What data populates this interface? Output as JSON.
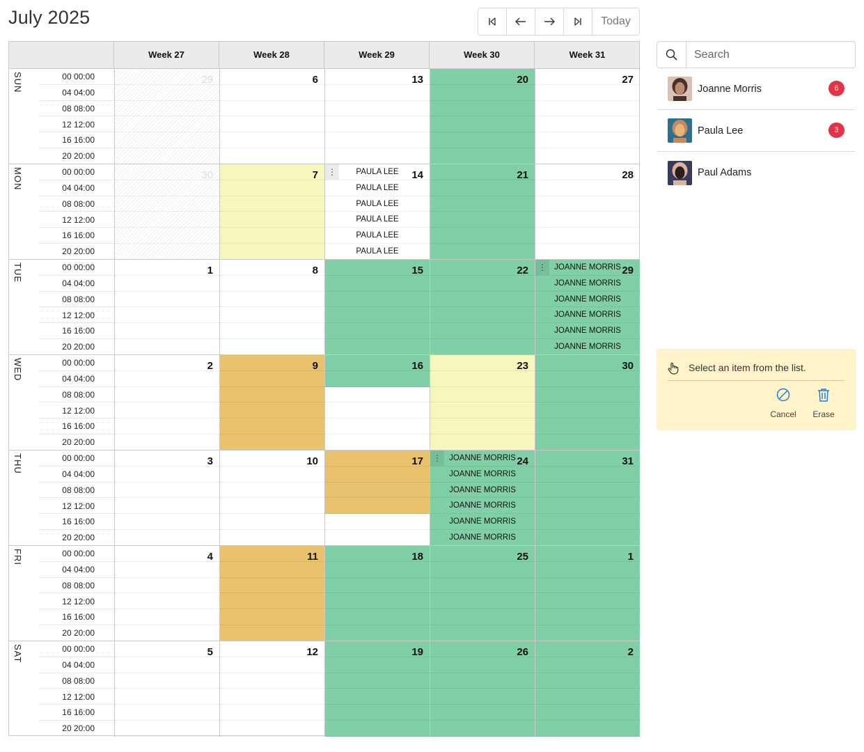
{
  "header": {
    "title": "July 2025"
  },
  "nav": {
    "first": "first-page",
    "prev": "previous",
    "next": "next",
    "last": "last-page",
    "today_label": "Today"
  },
  "weeks": [
    "Week 27",
    "Week 28",
    "Week 29",
    "Week 30",
    "Week 31"
  ],
  "times": [
    "00 00:00",
    "04 04:00",
    "08 08:00",
    "12 12:00",
    "16 16:00",
    "20 20:00"
  ],
  "days": [
    {
      "label": "SUN",
      "cells": [
        {
          "num": "29",
          "faint": true,
          "style": "hatch"
        },
        {
          "num": "6"
        },
        {
          "num": "13"
        },
        {
          "num": "20",
          "style": "green"
        },
        {
          "num": "27"
        }
      ]
    },
    {
      "label": "MON",
      "cells": [
        {
          "num": "30",
          "faint": true,
          "style": "hatch"
        },
        {
          "num": "7",
          "style": "yellow"
        },
        {
          "num": "14",
          "events": [
            "PAULA LEE",
            "PAULA LEE",
            "PAULA LEE",
            "PAULA LEE",
            "PAULA LEE",
            "PAULA LEE"
          ]
        },
        {
          "num": "21",
          "style": "green"
        },
        {
          "num": "28"
        }
      ]
    },
    {
      "label": "TUE",
      "cells": [
        {
          "num": "1"
        },
        {
          "num": "8"
        },
        {
          "num": "15",
          "style": "green"
        },
        {
          "num": "22",
          "style": "green"
        },
        {
          "num": "29",
          "style": "green",
          "events": [
            "JOANNE MORRIS",
            "JOANNE MORRIS",
            "JOANNE MORRIS",
            "JOANNE MORRIS",
            "JOANNE MORRIS",
            "JOANNE MORRIS"
          ]
        }
      ]
    },
    {
      "label": "WED",
      "cells": [
        {
          "num": "2"
        },
        {
          "num": "9",
          "style": "orange"
        },
        {
          "num": "16",
          "slots": [
            "green",
            "green",
            "",
            "",
            "",
            ""
          ]
        },
        {
          "num": "23",
          "style": "yellow"
        },
        {
          "num": "30",
          "style": "green"
        }
      ]
    },
    {
      "label": "THU",
      "cells": [
        {
          "num": "3"
        },
        {
          "num": "10"
        },
        {
          "num": "17",
          "slots": [
            "orange",
            "orange",
            "orange",
            "orange",
            "",
            ""
          ]
        },
        {
          "num": "24",
          "style": "green",
          "events": [
            "JOANNE MORRIS",
            "JOANNE MORRIS",
            "JOANNE MORRIS",
            "JOANNE MORRIS",
            "JOANNE MORRIS",
            "JOANNE MORRIS"
          ]
        },
        {
          "num": "31",
          "style": "green"
        }
      ]
    },
    {
      "label": "FRI",
      "cells": [
        {
          "num": "4"
        },
        {
          "num": "11",
          "style": "orange"
        },
        {
          "num": "18",
          "style": "green"
        },
        {
          "num": "25",
          "style": "green"
        },
        {
          "num": "1",
          "style": "green"
        }
      ]
    },
    {
      "label": "SAT",
      "cells": [
        {
          "num": "5"
        },
        {
          "num": "12"
        },
        {
          "num": "19",
          "style": "green"
        },
        {
          "num": "26",
          "style": "green"
        },
        {
          "num": "2",
          "style": "green"
        }
      ]
    }
  ],
  "colors": {
    "green": "#80cfa7",
    "yellow": "#f5f7bd",
    "orange": "#e8c26d",
    "badge": "#e03447",
    "hint_bg": "#fff4c9",
    "accent": "#1f7fe0"
  },
  "search": {
    "placeholder": "Search",
    "icon": "search-icon"
  },
  "people": [
    {
      "name": "Joanne Morris",
      "badge": "6",
      "avatar_colors": [
        "#d8c1b4",
        "#4a3128",
        "#b78c78"
      ]
    },
    {
      "name": "Paula Lee",
      "badge": "3",
      "avatar_colors": [
        "#2d6f8f",
        "#c18b62",
        "#e9b37a"
      ]
    },
    {
      "name": "Paul Adams",
      "badge": "",
      "avatar_colors": [
        "#3a3a5c",
        "#dbb39b",
        "#2b1e1a"
      ]
    }
  ],
  "hint": {
    "text": "Select an item from the list.",
    "icon": "hand-pointer-icon",
    "cancel_label": "Cancel",
    "erase_label": "Erase"
  }
}
